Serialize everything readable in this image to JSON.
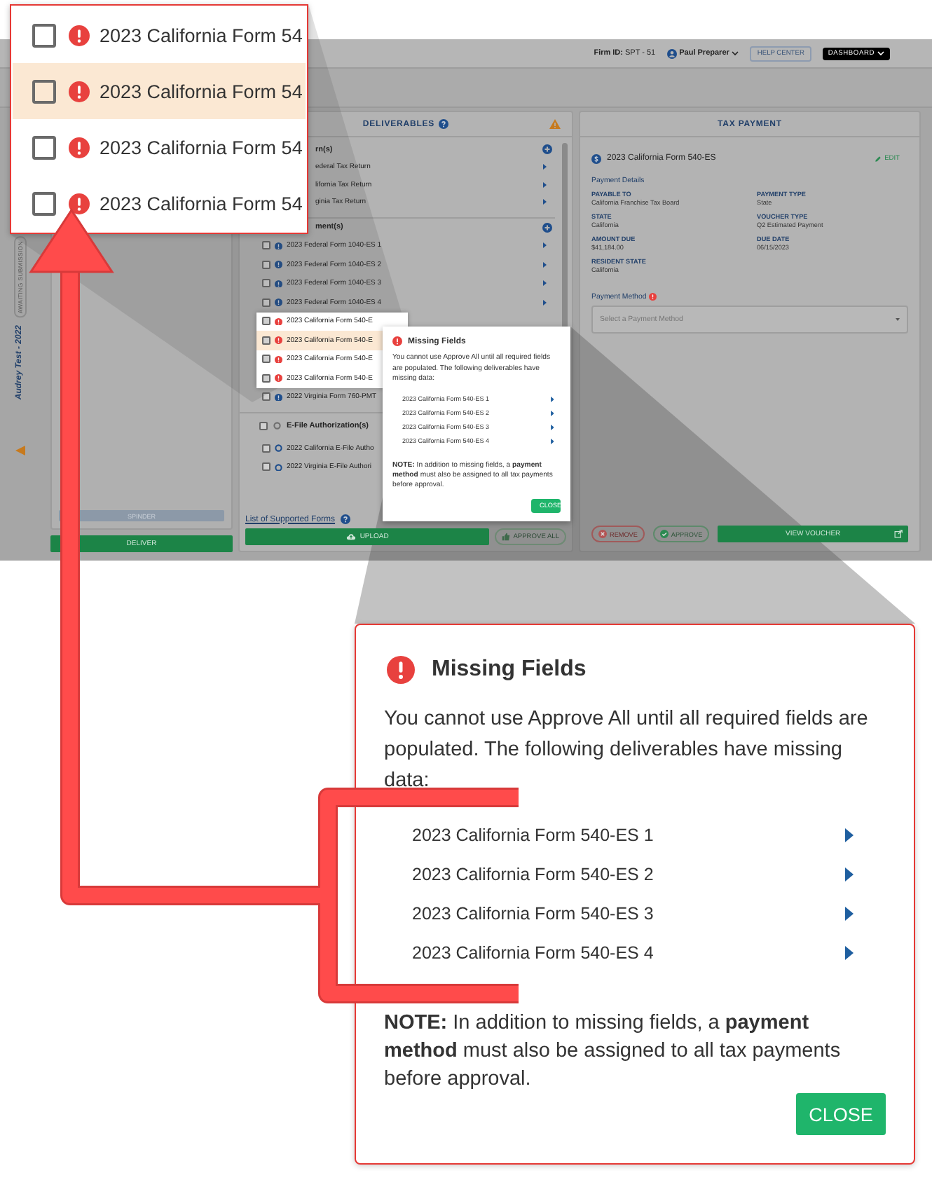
{
  "app": {
    "header": {
      "firm_id_label": "Firm ID:",
      "firm_id": "SPT - 51",
      "user": "Paul Preparer",
      "help_button": "HELP CENTER",
      "dashboard_button": "DASHBOARD"
    },
    "client_rail": {
      "status": "AWAITING SUBMISSION",
      "client_name": "Audrey Test - 2022"
    },
    "client_panel": {
      "secondary_button": "SPINDER",
      "deliver_button": "DELIVER"
    },
    "deliverables": {
      "title": "DELIVERABLES",
      "groups": [
        {
          "kind": "clipped",
          "title": "rn(s)",
          "items": [
            {
              "kind": "clipped",
              "label": "ederal Tax Return",
              "selected": false
            },
            {
              "kind": "clipped",
              "label": "lifornia Tax Return",
              "selected": false
            },
            {
              "kind": "clipped",
              "label": "ginia Tax Return",
              "selected": false
            }
          ]
        },
        {
          "kind": "clipped",
          "title": "ment(s)",
          "items": [
            {
              "kind": "info",
              "label": "2023 Federal Form 1040-ES 1",
              "checked": false,
              "selected": false,
              "zoomed": false
            },
            {
              "kind": "info",
              "label": "2023 Federal Form 1040-ES 2",
              "checked": false,
              "selected": false,
              "zoomed": false
            },
            {
              "kind": "info",
              "label": "2023 Federal Form 1040-ES 3",
              "checked": false,
              "selected": false,
              "zoomed": false
            },
            {
              "kind": "info",
              "label": "2023 Federal Form 1040-ES 4",
              "checked": false,
              "selected": false,
              "zoomed": false
            },
            {
              "kind": "error-short",
              "label": "2023 California Form 540-E",
              "checked": false,
              "selected": false,
              "zoomed": true
            },
            {
              "kind": "error-short",
              "label": "2023 California Form 540-E",
              "checked": false,
              "selected": true,
              "zoomed": true
            },
            {
              "kind": "error-short",
              "label": "2023 California Form 540-E",
              "checked": false,
              "selected": false,
              "zoomed": true
            },
            {
              "kind": "error-short",
              "label": "2023 California Form 540-E",
              "checked": false,
              "selected": false,
              "zoomed": true
            },
            {
              "kind": "info-short",
              "label": "2022 Virginia Form 760-PMT",
              "checked": false,
              "selected": false,
              "zoomed": false
            }
          ]
        },
        {
          "kind": "form",
          "title": "E-File Authorization(s)",
          "checked": false,
          "items": [
            {
              "kind": "pending-short",
              "label": "2022 California E-File Autho",
              "checked": false,
              "selected": false
            },
            {
              "kind": "pending-short",
              "label": "2022 Virginia E-File Authori",
              "checked": false,
              "selected": false
            }
          ]
        }
      ],
      "link": "List of Supported Forms",
      "upload_button": "UPLOAD",
      "approve_all_button": "APPROVE ALL"
    },
    "missing_fields_modal": {
      "title": "Missing Fields",
      "message": "You cannot use Approve All until all required fields are populated. The following deliverables have missing data:",
      "items": [
        "2023 California Form 540-ES 1",
        "2023 California Form 540-ES 2",
        "2023 California Form 540-ES 3",
        "2023 California Form 540-ES 4"
      ],
      "note": "**NOTE:** In addition to missing fields, a **payment method** must also be assigned to all tax payments before approval.",
      "close_button": "CLOSE"
    },
    "tax_payment": {
      "title": "TAX PAYMENT",
      "form": "2023 California Form 540-ES",
      "edit": "EDIT",
      "section": "Payment Details",
      "fields": [
        {
          "label": "PAYABLE TO",
          "value": "California Franchise Tax Board"
        },
        {
          "label": "PAYMENT TYPE",
          "value": "State"
        },
        {
          "label": "STATE",
          "value": "California"
        },
        {
          "label": "VOUCHER TYPE",
          "value": "Q2 Estimated Payment"
        },
        {
          "label": "AMOUNT DUE",
          "value": "$41,184.00"
        },
        {
          "label": "DUE DATE",
          "value": "06/15/2023"
        },
        {
          "label": "RESIDENT STATE",
          "value": "California"
        }
      ],
      "method_label": "Payment Method",
      "method_placeholder": "Select a Payment Method",
      "buttons": [
        {
          "kind": "remove",
          "label": "REMOVE"
        },
        {
          "kind": "approve",
          "label": "APPROVE"
        },
        {
          "kind": "view",
          "label": "VIEW VOUCHER"
        }
      ]
    }
  },
  "zoom_callout_list": {
    "items": [
      {
        "label": "2023 California Form 54",
        "checked": false,
        "selected": false
      },
      {
        "label": "2023 California Form 54",
        "checked": false,
        "selected": true
      },
      {
        "label": "2023 California Form 54",
        "checked": false,
        "selected": false
      },
      {
        "label": "2023 California Form 54",
        "checked": false,
        "selected": false
      }
    ]
  },
  "zoom_callout_modal": {
    "title": "Missing Fields",
    "message": "You cannot use Approve All until all required fields are populated. The following deliverables have missing data:",
    "items": [
      "2023 California Form 540-ES 1",
      "2023 California Form 540-ES 2",
      "2023 California Form 540-ES 3",
      "2023 California Form 540-ES 4"
    ],
    "note": "**NOTE:** In addition to missing fields, a **payment method** must also be assigned to all tax payments before approval.",
    "close_button": "CLOSE"
  }
}
